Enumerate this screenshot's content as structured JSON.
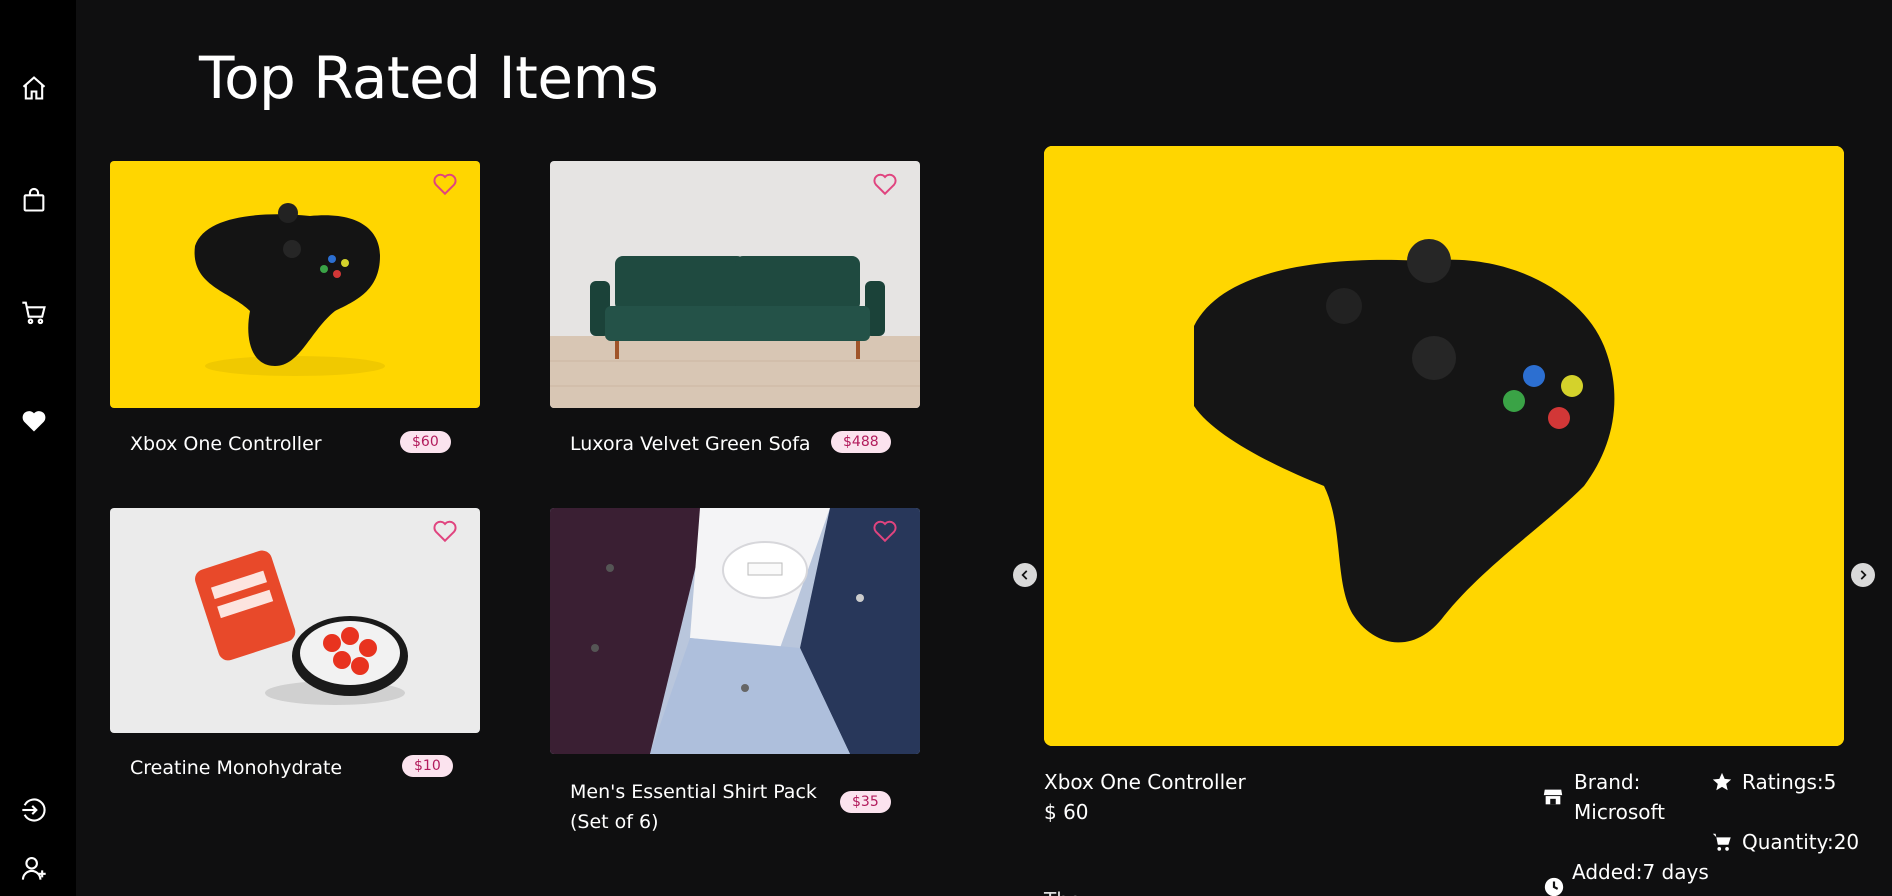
{
  "sidebar": {
    "icons": [
      "home-icon",
      "shopping-bag-icon",
      "cart-icon",
      "heart-icon",
      "logout-icon",
      "user-add-icon"
    ]
  },
  "page": {
    "title": "Top Rated Items"
  },
  "products": [
    {
      "name": "Xbox One Controller",
      "price": "$60",
      "image": "xbox-controller-yellow"
    },
    {
      "name": "Luxora Velvet Green Sofa",
      "price": "$488",
      "image": "green-velvet-sofa"
    },
    {
      "name": "Creatine Monohydrate",
      "price": "$10",
      "image": "creatine-jar-gummies"
    },
    {
      "name": "Men's Essential Shirt Pack (Set of 6)",
      "price": "$35",
      "image": "folded-shirts"
    }
  ],
  "detail": {
    "name": "Xbox One Controller",
    "price": "$ 60",
    "brand_label": "Brand:",
    "brand_value": "Microsoft",
    "ratings": "Ratings:5",
    "quantity": "Quantity:20",
    "added": "Added:7 days",
    "description": "The …"
  },
  "colors": {
    "background": "#0f0f10",
    "sidebar": "#000000",
    "accent_pink": "#e0447f",
    "price_badge_bg": "#fbe3ee",
    "price_badge_text": "#b21b5c",
    "yellow": "#ffd600"
  }
}
